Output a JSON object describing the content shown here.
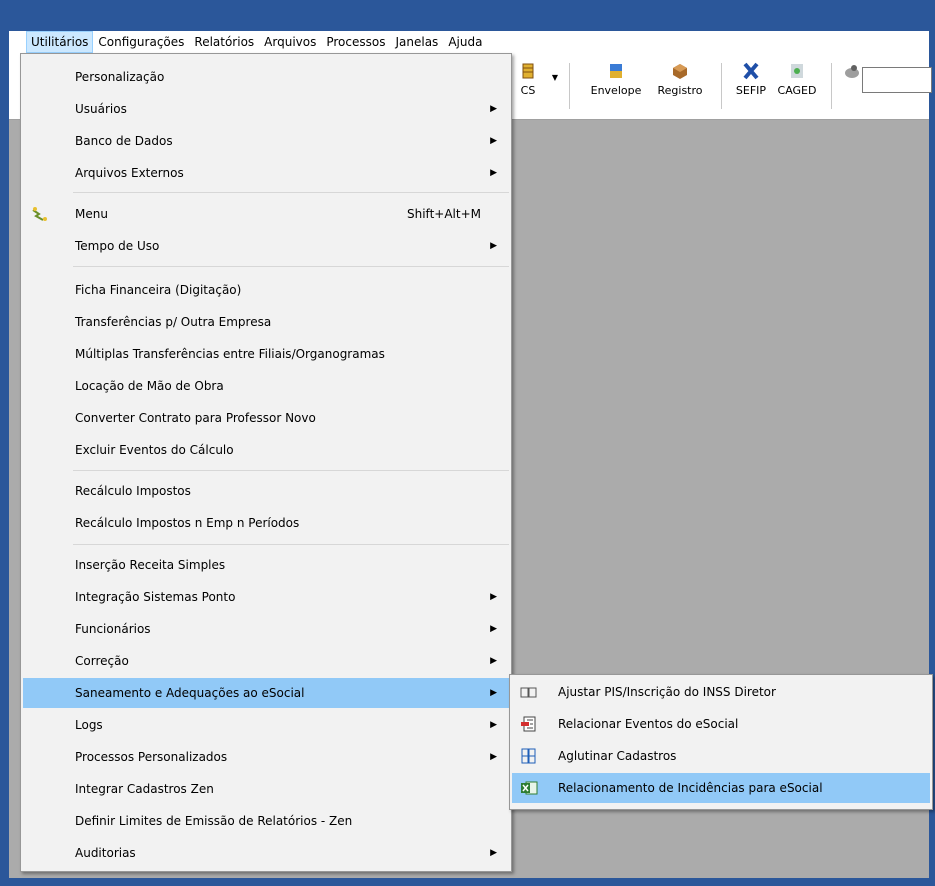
{
  "menubar": {
    "items": [
      "Utilitários",
      "Configurações",
      "Relatórios",
      "Arquivos",
      "Processos",
      "Janelas",
      "Ajuda"
    ]
  },
  "toolbar": {
    "partial_label": "CS",
    "envelope": "Envelope",
    "registro": "Registro",
    "sefip": "SEFIP",
    "caged": "CAGED"
  },
  "utilitarios_menu": {
    "personalizacao": "Personalização",
    "usuarios": "Usuários",
    "banco_dados": "Banco de Dados",
    "arquivos_externos": "Arquivos Externos",
    "menu": "Menu",
    "menu_shortcut": "Shift+Alt+M",
    "tempo_uso": "Tempo de Uso",
    "ficha_financeira": "Ficha Financeira (Digitação)",
    "transferencias": "Transferências p/ Outra Empresa",
    "multiplas_transferencias": "Múltiplas Transferências entre Filiais/Organogramas",
    "locacao": "Locação de Mão de Obra",
    "converter_contrato": "Converter Contrato para Professor Novo",
    "excluir_eventos": "Excluir Eventos do Cálculo",
    "recalculo_impostos": "Recálculo Impostos",
    "recalculo_periodos": "Recálculo Impostos n Emp n Períodos",
    "insercao_receita": "Inserção Receita Simples",
    "integracao_ponto": "Integração Sistemas Ponto",
    "funcionarios": "Funcionários",
    "correcao": "Correção",
    "saneamento": "Saneamento e Adequações ao eSocial",
    "logs": "Logs",
    "processos_personalizados": "Processos Personalizados",
    "integrar_zen": "Integrar Cadastros Zen",
    "definir_limites": "Definir Limites de Emissão de Relatórios - Zen",
    "auditorias": "Auditorias"
  },
  "saneamento_submenu": {
    "ajustar_pis": "Ajustar PIS/Inscrição do INSS Diretor",
    "relacionar_eventos": "Relacionar Eventos do eSocial",
    "aglutinar_cadastros": "Aglutinar Cadastros",
    "relacionamento_incidencias": "Relacionamento de Incidências para eSocial"
  },
  "colors": {
    "frame": "#2b579a",
    "highlight": "#91c9f7",
    "menubar_active": "#cce8ff",
    "menu_bg": "#f2f2f2"
  }
}
